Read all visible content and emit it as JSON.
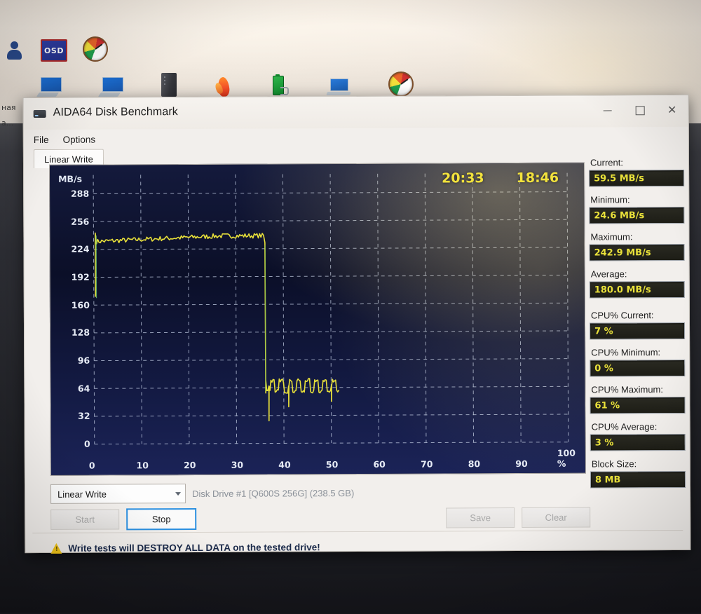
{
  "desktop": {
    "left_labels": [
      "ная",
      "а..."
    ],
    "icons_row1": [
      {
        "name": "people-icon",
        "label": ""
      },
      {
        "name": "osd-icon",
        "label": "OSD"
      },
      {
        "name": "gauge-icon",
        "label": ""
      }
    ],
    "icons_row2": [
      {
        "name": "desktop-pc-icon"
      },
      {
        "name": "desktop-pc-icon"
      },
      {
        "name": "server-tower-icon"
      },
      {
        "name": "flame-icon"
      },
      {
        "name": "battery-icon"
      },
      {
        "name": "laptop-icon"
      },
      {
        "name": "gauge-icon"
      }
    ]
  },
  "window": {
    "title": "AIDA64 Disk Benchmark",
    "minimize": "–",
    "maximize": "□",
    "close": "✕",
    "menu": [
      "File",
      "Options"
    ],
    "tab": "Linear Write"
  },
  "chart_data": {
    "type": "line",
    "title": "",
    "xlabel": "",
    "ylabel": "MB/s",
    "ylim": [
      0,
      300
    ],
    "xlim": [
      0,
      100
    ],
    "grid": true,
    "yticks": [
      0,
      32,
      64,
      96,
      128,
      160,
      192,
      224,
      256,
      288
    ],
    "xticks": [
      "0",
      "10",
      "20",
      "30",
      "40",
      "50",
      "60",
      "70",
      "80",
      "90",
      "100 %"
    ],
    "line_color": "#e8e03a",
    "bg_color": "#0b1030",
    "timers": [
      "20:33",
      "18:46"
    ],
    "series": [
      {
        "name": "Linear Write",
        "x": [
          0.0,
          0.3,
          0.6,
          1.0,
          1.6,
          2.4,
          3.4,
          4.6,
          6.0,
          7.6,
          9.4,
          11.4,
          13.6,
          16.0,
          18.6,
          21.4,
          24.4,
          27.6,
          31.0,
          33.2,
          34.4,
          35.2,
          35.6,
          35.9,
          36.1,
          36.3,
          36.6,
          37.0,
          37.6,
          38.4,
          39.4,
          40.6,
          42.0,
          43.6,
          45.4,
          46.2,
          47.4,
          48.6,
          49.6,
          50.4,
          51.2,
          51.8
        ],
        "y": [
          170.0,
          242.9,
          236.0,
          231.0,
          234.0,
          236.0,
          235.0,
          236.5,
          237.0,
          236.0,
          238.0,
          237.5,
          238.0,
          239.0,
          238.0,
          239.5,
          238.5,
          239.0,
          238.0,
          237.0,
          236.0,
          234.0,
          180.0,
          120.0,
          80.0,
          62.0,
          66.0,
          60.0,
          68.0,
          62.0,
          70.0,
          61.0,
          67.0,
          59.0,
          68.0,
          24.6,
          64.0,
          70.0,
          66.0,
          71.0,
          67.0,
          69.0
        ]
      }
    ],
    "noise_band": {
      "from_x": 36.2,
      "to_x": 51.8,
      "center": 66,
      "amplitude": 7
    },
    "spikes_down": [
      {
        "x": 36.9,
        "y": 26.0
      },
      {
        "x": 39.2,
        "y": 36.0
      },
      {
        "x": 41.0,
        "y": 42.0
      },
      {
        "x": 43.1,
        "y": 34.0
      },
      {
        "x": 44.9,
        "y": 46.0
      },
      {
        "x": 46.2,
        "y": 24.6
      },
      {
        "x": 48.9,
        "y": 44.0
      },
      {
        "x": 50.1,
        "y": 48.0
      }
    ]
  },
  "stats": [
    {
      "label": "Current:",
      "value": "59.5 MB/s"
    },
    {
      "label": "Minimum:",
      "value": "24.6 MB/s"
    },
    {
      "label": "Maximum:",
      "value": "242.9 MB/s"
    },
    {
      "label": "Average:",
      "value": "180.0 MB/s"
    },
    {
      "label": "CPU% Current:",
      "value": "7 %"
    },
    {
      "label": "CPU% Minimum:",
      "value": "0 %"
    },
    {
      "label": "CPU% Maximum:",
      "value": "61 %"
    },
    {
      "label": "CPU% Average:",
      "value": "3 %"
    },
    {
      "label": "Block Size:",
      "value": "8 MB"
    }
  ],
  "controls": {
    "test_mode": "Linear Write",
    "drive": "Disk Drive #1  [Q600S 256G]  (238.5 GB)",
    "start": "Start",
    "stop": "Stop",
    "save": "Save",
    "clear": "Clear",
    "warning": "Write tests will DESTROY ALL DATA on the tested drive!"
  }
}
